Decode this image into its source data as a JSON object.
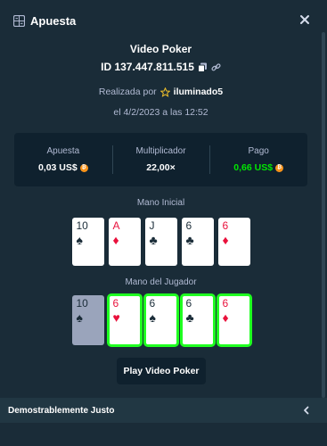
{
  "header": {
    "title": "Apuesta",
    "title_icon": "bet-slip-icon",
    "close_icon": "close-icon"
  },
  "bet": {
    "game": "Video Poker",
    "id": "ID 137.447.811.515",
    "placed_by_prefix": "Realizada por",
    "user": "iluminado5",
    "date": "el 4/2/2023 a las 12:52"
  },
  "stats": {
    "bet_label": "Apuesta",
    "bet_value": "0,03 US$",
    "multiplier_label": "Multiplicador",
    "multiplier_value": "22,00×",
    "payout_label": "Pago",
    "payout_value": "0,66 US$"
  },
  "initial_hand": {
    "label": "Mano Inicial",
    "cards": [
      {
        "rank": "10",
        "suit": "♠",
        "color": "black"
      },
      {
        "rank": "A",
        "suit": "♦",
        "color": "red"
      },
      {
        "rank": "J",
        "suit": "♣",
        "color": "black"
      },
      {
        "rank": "6",
        "suit": "♣",
        "color": "black"
      },
      {
        "rank": "6",
        "suit": "♦",
        "color": "red"
      }
    ]
  },
  "player_hand": {
    "label": "Mano del Jugador",
    "cards": [
      {
        "rank": "10",
        "suit": "♠",
        "color": "black",
        "held": false
      },
      {
        "rank": "6",
        "suit": "♥",
        "color": "red",
        "held": true
      },
      {
        "rank": "6",
        "suit": "♠",
        "color": "black",
        "held": true
      },
      {
        "rank": "6",
        "suit": "♣",
        "color": "black",
        "held": true
      },
      {
        "rank": "6",
        "suit": "♦",
        "color": "red",
        "held": true
      }
    ]
  },
  "actions": {
    "play_label": "Play Video Poker"
  },
  "footer": {
    "label": "Demostrablemente Justo"
  },
  "colors": {
    "background": "#1a2c38",
    "panel": "#0f212e",
    "green": "#00e701",
    "held_outline": "#1fff20",
    "red_suit": "#e9113c"
  }
}
